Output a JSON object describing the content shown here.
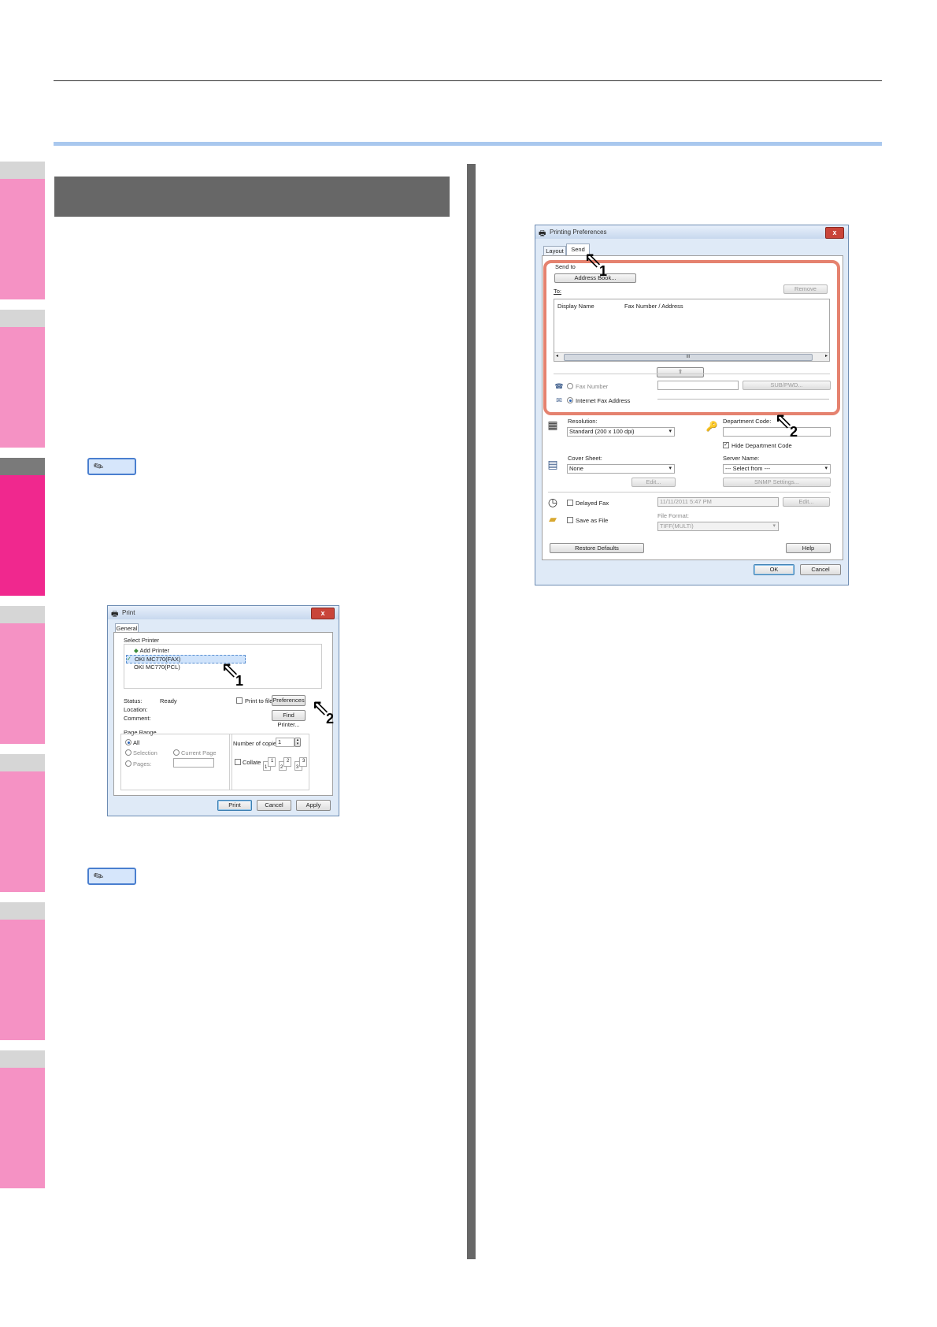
{
  "print_dialog": {
    "title": "Print",
    "close": "x",
    "tab_general": "General",
    "select_printer_label": "Select Printer",
    "printers": [
      "Add Printer",
      "OKI MC770(FAX)",
      "OKI MC770(PCL)"
    ],
    "status_label": "Status:",
    "status_value": "Ready",
    "location_label": "Location:",
    "comment_label": "Comment:",
    "print_to_file": "Print to file",
    "preferences_button": "Preferences",
    "find_printer_button": "Find Printer...",
    "page_range_label": "Page Range",
    "range_all": "All",
    "range_selection": "Selection",
    "range_current_page": "Current Page",
    "range_pages": "Pages:",
    "copies_label": "Number of copies:",
    "copies_value": "1",
    "collate": "Collate",
    "collate_pages": [
      "1",
      "1",
      "2",
      "2",
      "3",
      "3"
    ],
    "print_button": "Print",
    "cancel_button": "Cancel",
    "apply_button": "Apply",
    "callouts": [
      "1",
      "2"
    ]
  },
  "prefs_dialog": {
    "title": "Printing Preferences",
    "close": "x",
    "tabs": [
      "Layout",
      "Send"
    ],
    "send_to_label": "Send to",
    "address_book_button": "Address Book...",
    "to_label": "To:",
    "remove_button": "Remove",
    "col_display_name": "Display Name",
    "col_fax_number": "Fax Number / Address",
    "scroll_mid": "III",
    "fax_number_radio": "Fax Number",
    "sub_pwd_button": "SUB/PWD...",
    "internet_fax_radio": "Internet Fax Address",
    "resolution_label": "Resolution:",
    "resolution_value": "Standard (200 x 100 dpi)",
    "department_code_label": "Department Code:",
    "hide_department_code": "Hide Department Code",
    "cover_sheet_label": "Cover Sheet:",
    "cover_sheet_value": "None",
    "edit_button": "Edit...",
    "server_name_label": "Server Name:",
    "server_name_value": "--- Select from ---",
    "snmp_settings_button": "SNMP Settings...",
    "delayed_fax": "Delayed Fax",
    "delayed_fax_time": "11/11/2011 5:47 PM",
    "edit2_button": "Edit...",
    "save_as_file": "Save as File",
    "file_format_label": "File Format:",
    "file_format_value": "TIFF(MULTI)",
    "restore_defaults_button": "Restore Defaults",
    "help_button": "Help",
    "ok_button": "OK",
    "cancel_button": "Cancel",
    "callouts": [
      "1",
      "2"
    ],
    "highlight_color": "#e5826f"
  },
  "colors": {
    "section_header": "#676767",
    "accent_rule": "#a9c8ee",
    "tab_pink": "#f592c4",
    "tab_pink_active": "#f0288e",
    "tab_gray": "#d6d6d6"
  }
}
